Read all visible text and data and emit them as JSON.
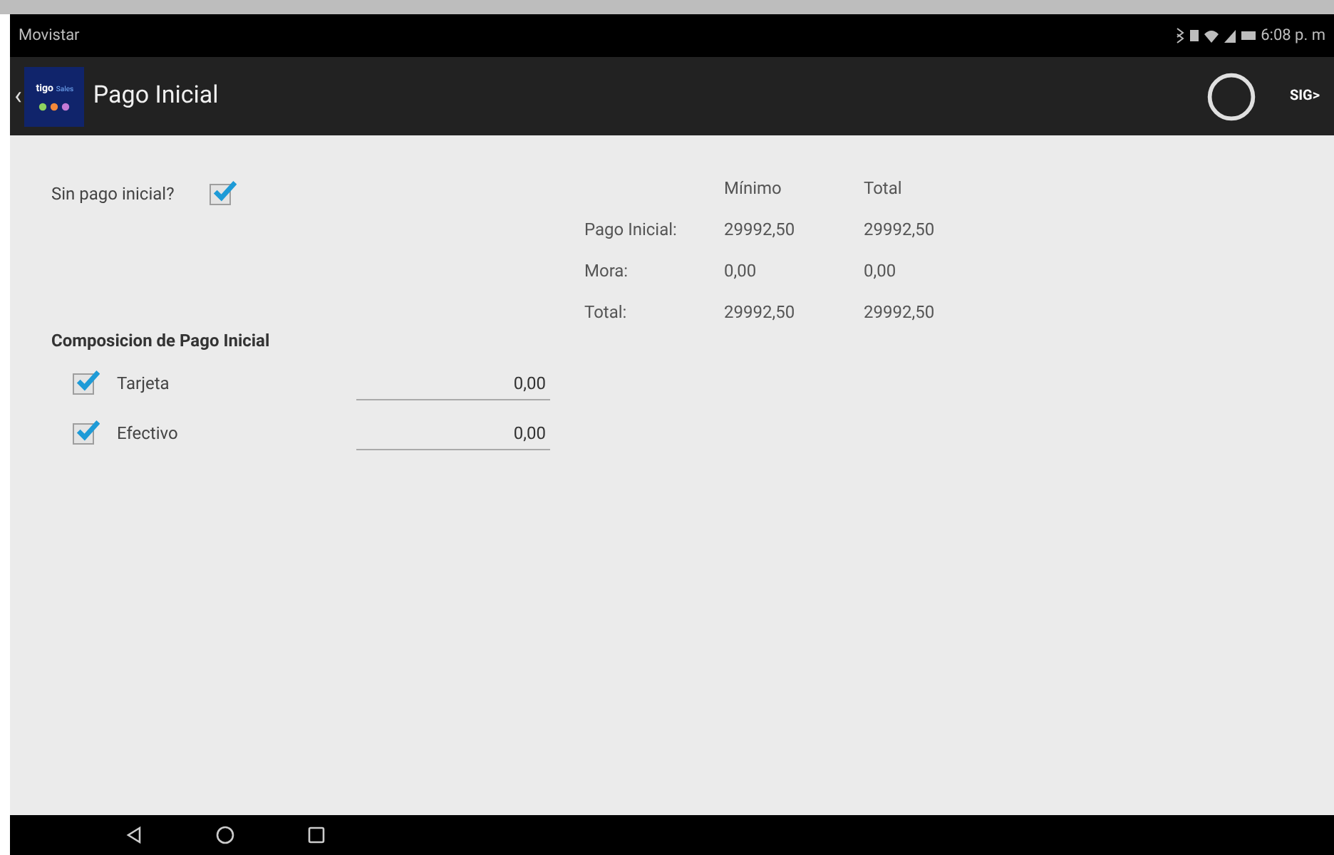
{
  "status_bar": {
    "carrier": "Movistar",
    "time": "6:08 p. m"
  },
  "app_bar": {
    "back": "‹",
    "logo": {
      "brand": "tigo",
      "product": "Sales"
    },
    "title": "Pago Inicial",
    "next": "SIG>"
  },
  "sin_pago": {
    "label": "Sin pago inicial?",
    "checked": true
  },
  "summary": {
    "columns": [
      "Mínimo",
      "Total"
    ],
    "rows": [
      {
        "label": "Pago Inicial:",
        "values": [
          "29992,50",
          "29992,50"
        ]
      },
      {
        "label": "Mora:",
        "values": [
          "0,00",
          "0,00"
        ]
      },
      {
        "label": "Total:",
        "values": [
          "29992,50",
          "29992,50"
        ]
      }
    ]
  },
  "composition": {
    "heading": "Composicion de Pago Inicial",
    "items": [
      {
        "label": "Tarjeta",
        "checked": true,
        "value": "0,00"
      },
      {
        "label": "Efectivo",
        "checked": true,
        "value": "0,00"
      }
    ]
  }
}
